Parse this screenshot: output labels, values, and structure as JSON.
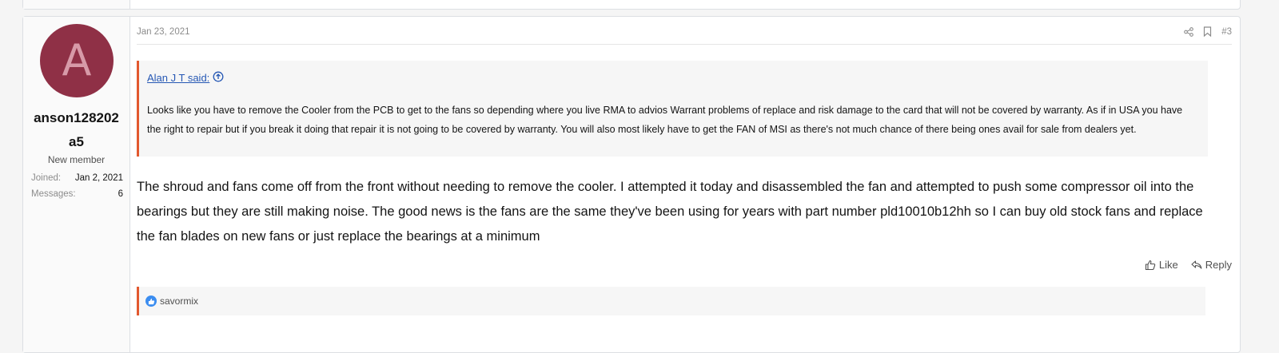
{
  "post": {
    "user": {
      "avatar_letter": "A",
      "avatar_color": "#8f3046",
      "username_line1": "anson128202",
      "username_line2": "a5",
      "title": "New member",
      "stats": [
        {
          "label": "Joined:",
          "value": "Jan 2, 2021"
        },
        {
          "label": "Messages:",
          "value": "6"
        }
      ]
    },
    "date": "Jan 23, 2021",
    "post_number": "#3",
    "quote": {
      "author": "Alan J T said:",
      "text": "Looks like you have to remove the Cooler from the PCB to get to the fans so depending where you live RMA to advios Warrant problems of replace and risk damage to the card that will not be covered by warranty. As if in USA you have the right to repair but if you break it doing that repair it is not going to be covered by warranty. You will also most likely have to get the FAN of MSI as there's not much chance of there being ones avail for sale from dealers yet."
    },
    "body": "The shroud and fans come off from the front without needing to remove the cooler. I attempted it today and disassembled the fan and attempted to push some compressor oil into the bearings but they are still making noise. The good news is the fans are the same they've been using for years with part number pld10010b12hh so I can buy old stock fans and replace the fan blades on new fans or just replace the bearings at a minimum",
    "actions": {
      "like": "Like",
      "reply": "Reply"
    },
    "reactions": {
      "users": "savormix",
      "icon": "thumbs-up-icon"
    },
    "accent_color": "#e2592f",
    "link_color": "#2557b4"
  }
}
